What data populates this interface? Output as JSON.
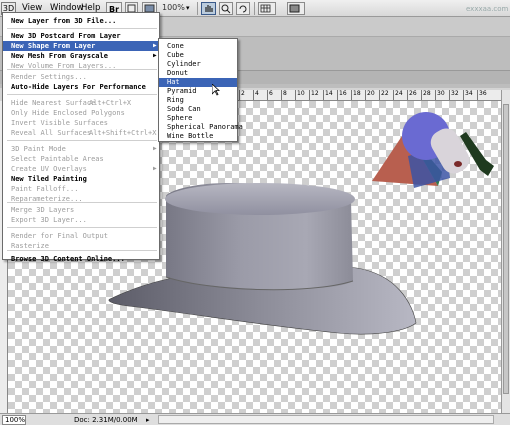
{
  "menubar": {
    "menu_3d": "3D",
    "view": "View",
    "window": "Window",
    "help": "Help",
    "zoom": "100%",
    "watermark": "exxxaa.com"
  },
  "menu_3d": {
    "items": [
      {
        "label": "New Layer from 3D File...",
        "state": "bold"
      },
      {
        "label": "New 3D Postcard From Layer",
        "state": "bold"
      },
      {
        "label": "New Shape From Layer",
        "state": "highlight",
        "submenu": true
      },
      {
        "label": "New Mesh From Grayscale",
        "state": "bold",
        "submenu": true
      },
      {
        "label": "New Volume From Layers...",
        "state": "disabled"
      },
      {
        "label": "Render Settings...",
        "state": "disabled"
      },
      {
        "label": "Auto-Hide Layers For Performance",
        "state": "bold"
      },
      {
        "label": "Hide Nearest Surface",
        "state": "disabled",
        "shortcut": "Alt+Ctrl+X"
      },
      {
        "label": "Only Hide Enclosed Polygons",
        "state": "disabled"
      },
      {
        "label": "Invert Visible Surfaces",
        "state": "disabled"
      },
      {
        "label": "Reveal All Surfaces",
        "state": "disabled",
        "shortcut": "Alt+Shift+Ctrl+X"
      },
      {
        "label": "3D Paint Mode",
        "state": "disabled",
        "submenu": true
      },
      {
        "label": "Select Paintable Areas",
        "state": "disabled"
      },
      {
        "label": "Create UV Overlays",
        "state": "disabled",
        "submenu": true
      },
      {
        "label": "New Tiled Painting",
        "state": "bold"
      },
      {
        "label": "Paint Falloff...",
        "state": "disabled"
      },
      {
        "label": "Reparameterize...",
        "state": "disabled"
      },
      {
        "label": "Merge 3D Layers",
        "state": "disabled"
      },
      {
        "label": "Export 3D Layer...",
        "state": "disabled"
      },
      {
        "label": "Render for Final Output",
        "state": "disabled"
      },
      {
        "label": "Rasterize",
        "state": "disabled"
      },
      {
        "label": "Browse 3D Content Online...",
        "state": "bold"
      }
    ]
  },
  "submenu_shapes": {
    "items": [
      {
        "label": "Cone"
      },
      {
        "label": "Cube"
      },
      {
        "label": "Cylinder"
      },
      {
        "label": "Donut"
      },
      {
        "label": "Hat",
        "highlight": true
      },
      {
        "label": "Pyramid"
      },
      {
        "label": "Ring"
      },
      {
        "label": "Soda Can"
      },
      {
        "label": "Sphere"
      },
      {
        "label": "Spherical Panorama"
      },
      {
        "label": "Wine Bottle"
      }
    ]
  },
  "ruler": {
    "h_ticks": [
      "2",
      "4",
      "6",
      "8",
      "10",
      "12",
      "14",
      "16",
      "18",
      "20",
      "22",
      "24",
      "26",
      "28",
      "30",
      "32",
      "34",
      "36"
    ]
  },
  "statusbar": {
    "zoom": "100%",
    "doc_info": "Doc: 2.31M/0.00M",
    "arrow": "▸"
  }
}
